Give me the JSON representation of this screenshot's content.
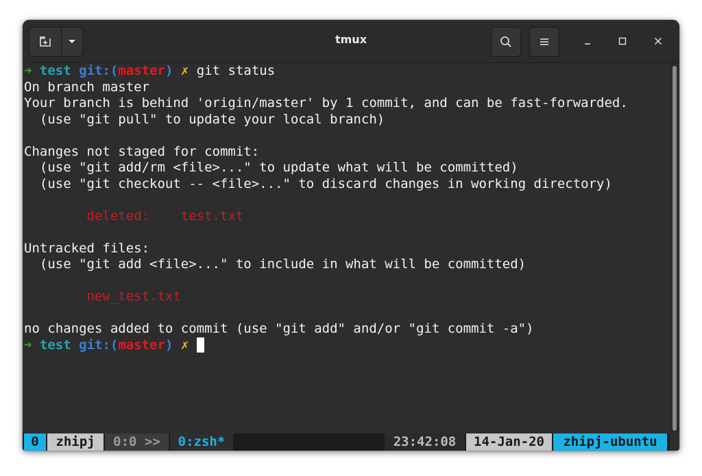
{
  "window": {
    "title": "tmux"
  },
  "terminal": {
    "prompt": {
      "arrow": "➜",
      "dir": "test",
      "git_prefix": "git:(",
      "branch": "master",
      "git_suffix": ")",
      "dirty_mark": "✗"
    },
    "command": "git status",
    "lines": {
      "l2": "On branch master",
      "l3": "Your branch is behind 'origin/master' by 1 commit, and can be fast-forwarded.",
      "l4": "  (use \"git pull\" to update your local branch)",
      "l6": "Changes not staged for commit:",
      "l7": "  (use \"git add/rm <file>...\" to update what will be committed)",
      "l8": "  (use \"git checkout -- <file>...\" to discard changes in working directory)",
      "l10": "        deleted:    test.txt",
      "l12": "Untracked files:",
      "l13": "  (use \"git add <file>...\" to include in what will be committed)",
      "l15": "        new_test.txt",
      "l17": "no changes added to commit (use \"git add\" and/or \"git commit -a\")"
    }
  },
  "status_bar": {
    "session_index": "0",
    "session_name": "zhipj",
    "pane_info": "0:0 >>",
    "window_label": "0:zsh*",
    "time": "23:42:08",
    "date": "14-Jan-20",
    "hostname": "zhipj-ubuntu"
  },
  "colors": {
    "terminal_bg": "#2d2d2d",
    "arrow": "#4ea21c",
    "dir": "#2aa1b3",
    "git": "#3d7ed6",
    "branch": "#e01b24",
    "dirty": "#e9bb2c",
    "status_cyan": "#19b3e6",
    "status_gray": "#c7c7c7"
  },
  "icons": {
    "new_tab": "new-tab-icon",
    "dropdown": "chevron-down-icon",
    "search": "search-icon",
    "menu": "hamburger-menu-icon",
    "minimize": "minimize-icon",
    "maximize": "maximize-icon",
    "close": "close-icon"
  }
}
